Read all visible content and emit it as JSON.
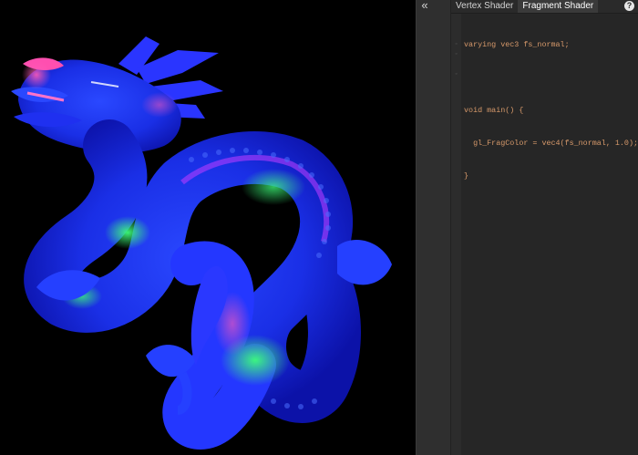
{
  "panel": {
    "collapse_glyph": "«",
    "tabs": [
      {
        "label": "Vertex Shader",
        "active": false
      },
      {
        "label": "Fragment Shader",
        "active": true
      }
    ],
    "help_glyph": "?"
  },
  "editor": {
    "lines": [
      "varying vec3 fs_normal;",
      "",
      "void main() {",
      "  gl_FragColor = vec4(fs_normal, 1.0);",
      "}",
      ""
    ],
    "gutter_markers": [
      "",
      "",
      "◦",
      "◦",
      "",
      "◦"
    ]
  },
  "viewport": {
    "content": "normal-shaded-dragon-model",
    "colors": {
      "primary": "#1f3bff",
      "accent_pink": "#ff4fb0",
      "accent_green": "#28ff6a",
      "accent_purple": "#b43cff",
      "background": "#000000"
    }
  }
}
